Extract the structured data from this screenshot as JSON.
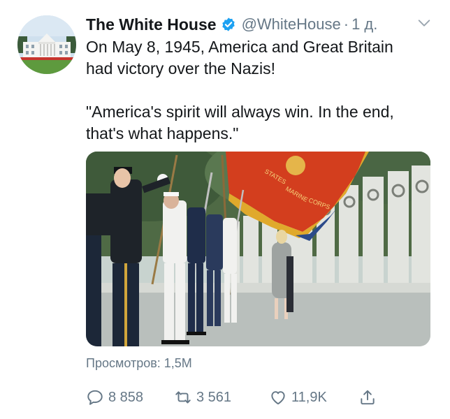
{
  "tweet": {
    "author": {
      "display_name": "The White House",
      "handle": "@WhiteHouse",
      "verified": true,
      "avatar_icon": "white-house-photo"
    },
    "separator": "·",
    "timestamp": "1 д.",
    "text_lines": [
      "On May 8, 1945, America and Great Britain",
      "had victory over the Nazis!",
      "\"America's spirit will always win. In the end,",
      "that's what happens.\""
    ],
    "media": {
      "description_icon": "honor-guard-photo",
      "flag_text": [
        "STATES",
        "MARINE",
        "CORPS"
      ]
    },
    "views": "Просмотров: 1,5M",
    "actions": {
      "reply": {
        "icon": "reply-icon",
        "count": "8 858"
      },
      "retweet": {
        "icon": "retweet-icon",
        "count": "3 561"
      },
      "like": {
        "icon": "heart-icon",
        "count": "11,9K"
      },
      "share": {
        "icon": "share-icon"
      }
    },
    "colors": {
      "text_primary": "#14171a",
      "text_secondary": "#657786",
      "verified_blue": "#1da1f2"
    }
  }
}
